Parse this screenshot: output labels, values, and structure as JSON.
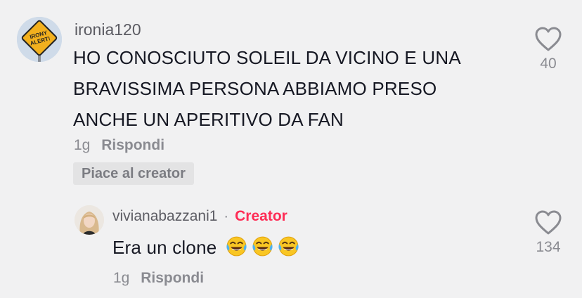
{
  "comment1": {
    "username": "ironia120",
    "avatar_sign_text": [
      "IRONY",
      "ALERT!"
    ],
    "text_lines": [
      "HO CONOSCIUTO SOLEIL DA VICINO E UNA",
      "BRAVISSIMA PERSONA ABBIAMO PRESO",
      "ANCHE UN APERITIVO DA FAN"
    ],
    "age": "1g",
    "reply_label": "Rispondi",
    "liked_by_creator_label": "Piace al creator",
    "like_count": "40"
  },
  "comment2": {
    "username": "vivianabazzani1",
    "separator": "·",
    "creator_badge": "Creator",
    "text": "Era un clone",
    "emoji": [
      "face-with-tears-of-joy",
      "face-with-tears-of-joy",
      "face-with-tears-of-joy"
    ],
    "age": "1g",
    "reply_label": "Rispondi",
    "like_count": "134"
  },
  "colors": {
    "background": "#f1f1f2",
    "creator_accent": "#fe2c55",
    "primary_text": "#161823",
    "secondary_text": "#8a8b91"
  }
}
